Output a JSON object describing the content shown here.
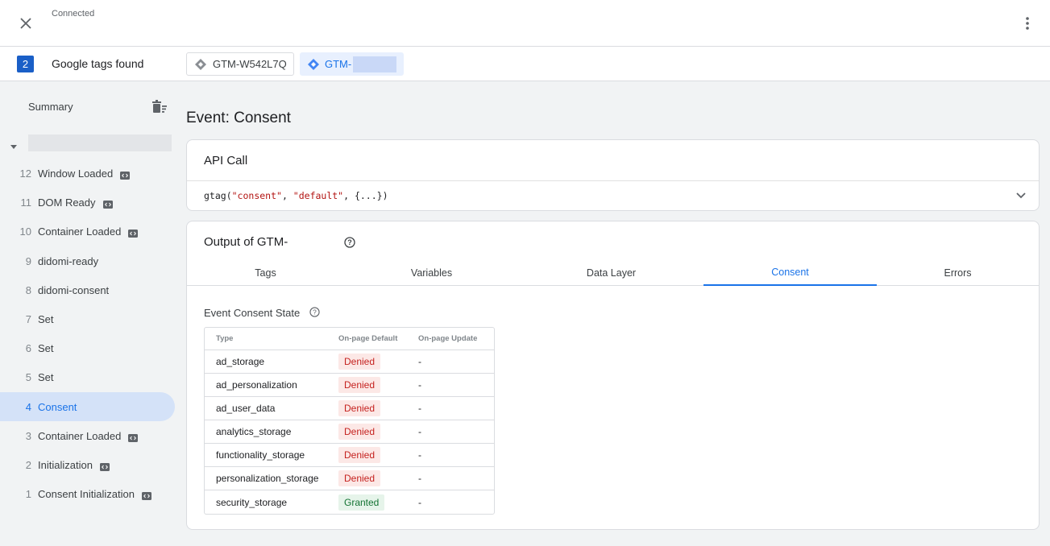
{
  "header": {
    "status": "Connected"
  },
  "tags_row": {
    "count": "2",
    "label": "Google tags found",
    "chips": [
      {
        "id": "GTM-W542L7Q",
        "active": false
      },
      {
        "id": "GTM-",
        "active": true
      }
    ]
  },
  "sidebar": {
    "summary_label": "Summary",
    "events": [
      {
        "num": "12",
        "label": "Window Loaded",
        "has_code_icon": true,
        "selected": false
      },
      {
        "num": "11",
        "label": "DOM Ready",
        "has_code_icon": true,
        "selected": false
      },
      {
        "num": "10",
        "label": "Container Loaded",
        "has_code_icon": true,
        "selected": false
      },
      {
        "num": "9",
        "label": "didomi-ready",
        "has_code_icon": false,
        "selected": false
      },
      {
        "num": "8",
        "label": "didomi-consent",
        "has_code_icon": false,
        "selected": false
      },
      {
        "num": "7",
        "label": "Set",
        "has_code_icon": false,
        "selected": false
      },
      {
        "num": "6",
        "label": "Set",
        "has_code_icon": false,
        "selected": false
      },
      {
        "num": "5",
        "label": "Set",
        "has_code_icon": false,
        "selected": false
      },
      {
        "num": "4",
        "label": "Consent",
        "has_code_icon": false,
        "selected": true
      },
      {
        "num": "3",
        "label": "Container Loaded",
        "has_code_icon": true,
        "selected": false
      },
      {
        "num": "2",
        "label": "Initialization",
        "has_code_icon": true,
        "selected": false
      },
      {
        "num": "1",
        "label": "Consent Initialization",
        "has_code_icon": true,
        "selected": false
      }
    ]
  },
  "main": {
    "title": "Event: Consent",
    "api_call": {
      "title": "API Call",
      "code_prefix": "gtag(",
      "arg1": "\"consent\"",
      "sep": ", ",
      "arg2": "\"default\"",
      "code_suffix": ", {...})"
    },
    "output": {
      "title": "Output of GTM-",
      "tabs": [
        "Tags",
        "Variables",
        "Data Layer",
        "Consent",
        "Errors"
      ],
      "active_tab": "Consent",
      "consent_state_title": "Event Consent State",
      "table": {
        "headers": [
          "Type",
          "On-page Default",
          "On-page Update"
        ],
        "rows": [
          {
            "type": "ad_storage",
            "default": "Denied",
            "update": "-"
          },
          {
            "type": "ad_personalization",
            "default": "Denied",
            "update": "-"
          },
          {
            "type": "ad_user_data",
            "default": "Denied",
            "update": "-"
          },
          {
            "type": "analytics_storage",
            "default": "Denied",
            "update": "-"
          },
          {
            "type": "functionality_storage",
            "default": "Denied",
            "update": "-"
          },
          {
            "type": "personalization_storage",
            "default": "Denied",
            "update": "-"
          },
          {
            "type": "security_storage",
            "default": "Granted",
            "update": "-"
          }
        ]
      }
    }
  },
  "colors": {
    "accent": "#1a73e8",
    "badge": "#1a5fc7",
    "denied_bg": "#fce8e6",
    "denied_text": "#c5221f",
    "granted_bg": "#e6f4ea",
    "granted_text": "#137333",
    "selected_bg": "#d4e2f8"
  },
  "icons": [
    "close-icon",
    "more-vert-icon",
    "gtm-diamond-icon",
    "clear-all-icon",
    "caret-down-icon",
    "code-icon",
    "chevron-down-icon",
    "help-icon"
  ]
}
